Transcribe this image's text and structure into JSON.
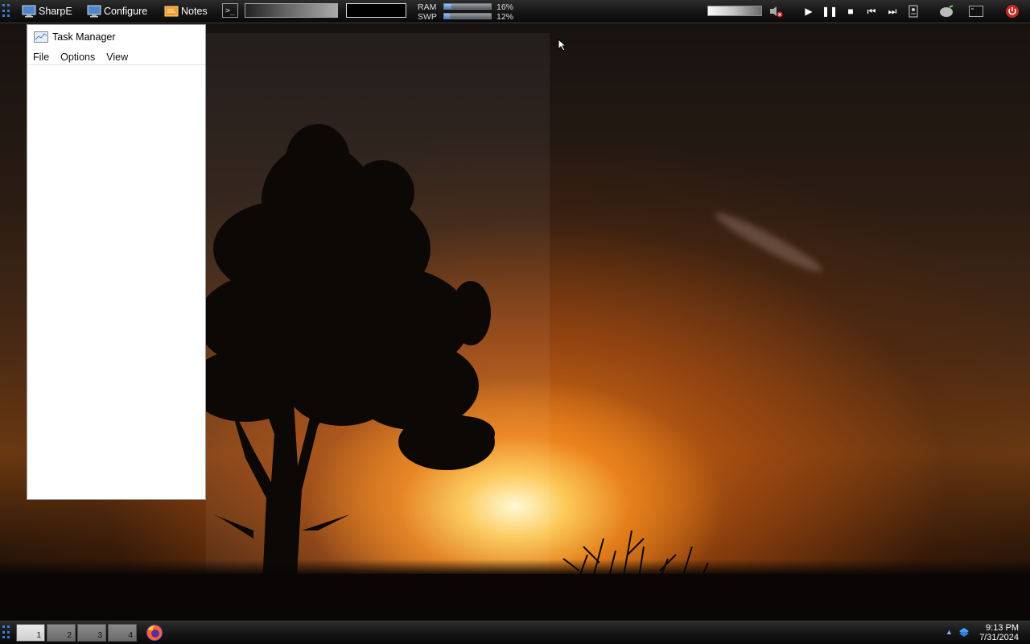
{
  "top_panel": {
    "launchers": [
      {
        "label": "SharpE",
        "icon": "monitor-icon"
      },
      {
        "label": "Configure",
        "icon": "monitor-icon"
      },
      {
        "label": "Notes",
        "icon": "notes-icon"
      }
    ],
    "terminal_icon": ">_",
    "meters": [
      {
        "label": "RAM",
        "percent_text": "16%",
        "value": 0.16
      },
      {
        "label": "SWP",
        "percent_text": "12%",
        "value": 0.12
      }
    ],
    "media_controls": [
      "play",
      "pause",
      "stop",
      "previous",
      "next"
    ]
  },
  "task_manager": {
    "title": "Task Manager",
    "menu": [
      "File",
      "Options",
      "View"
    ]
  },
  "taskbar": {
    "workspaces": [
      {
        "number": "1",
        "active": true
      },
      {
        "number": "2",
        "active": false
      },
      {
        "number": "3",
        "active": false
      },
      {
        "number": "4",
        "active": false
      }
    ],
    "clock_time": "9:13 PM",
    "clock_date": "7/31/2024"
  },
  "colors": {
    "accent": "#3a7bd5",
    "power": "#e0332a"
  }
}
